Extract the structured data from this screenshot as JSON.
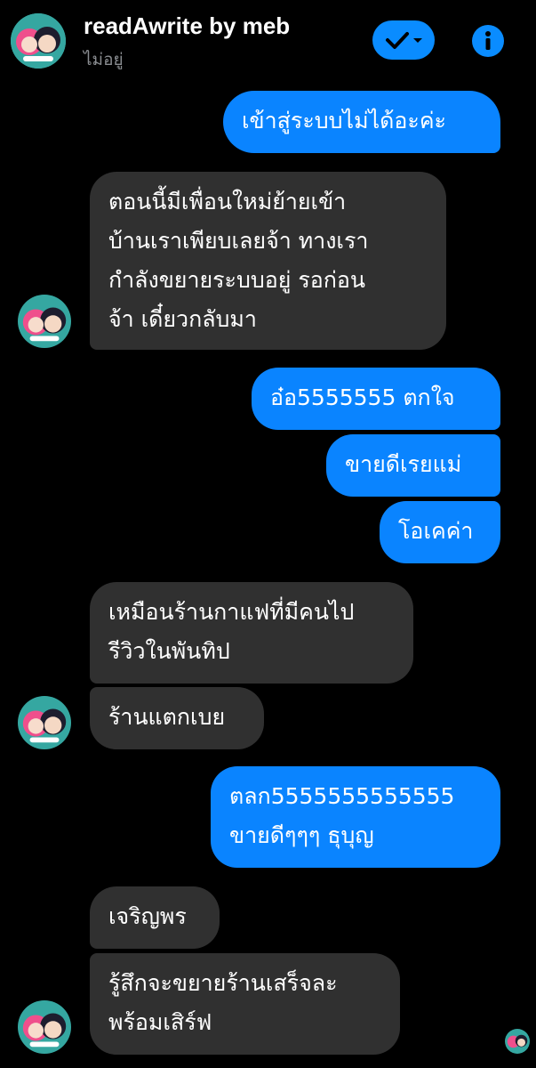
{
  "header": {
    "title": "readAwrite by meb",
    "status": "ไม่อยู่",
    "colors": {
      "accent": "#0a8cff",
      "background": "#000000"
    },
    "icons": {
      "check": "check-icon",
      "dropdown": "chevron-down-icon",
      "info": "info-icon"
    }
  },
  "messages": [
    {
      "side": "out",
      "lines": [
        "เข้าสู่ระบบไม่ได้อะค่ะ"
      ]
    },
    {
      "side": "in",
      "lines": [
        "ตอนนี้มีเพื่อนใหม่ย้ายเข้า",
        "บ้านเราเพียบเลยจ้า ทางเรา",
        "กำลังขยายระบบอยู่ รอก่อน",
        "จ้า เดี๋ยวกลับมา"
      ]
    },
    {
      "side": "out",
      "lines": [
        "อ๋อ5555555 ตกใจ"
      ]
    },
    {
      "side": "out",
      "lines": [
        "ขายดีเรยแม่"
      ]
    },
    {
      "side": "out",
      "lines": [
        "โอเคค่า"
      ]
    },
    {
      "side": "in",
      "lines": [
        "เหมือนร้านกาแฟที่มีคนไป",
        "รีวิวในพันทิป"
      ]
    },
    {
      "side": "in",
      "lines": [
        "ร้านแตกเบย"
      ]
    },
    {
      "side": "out",
      "lines": [
        "ตลก5555555555555",
        "ขายดีๆๆๆ ธุบุญ"
      ]
    },
    {
      "side": "in",
      "lines": [
        "เจริญพร"
      ]
    },
    {
      "side": "in",
      "lines": [
        "รู้สึกจะขยายร้านเสร็จละ",
        "พร้อมเสิร์ฟ"
      ]
    }
  ]
}
